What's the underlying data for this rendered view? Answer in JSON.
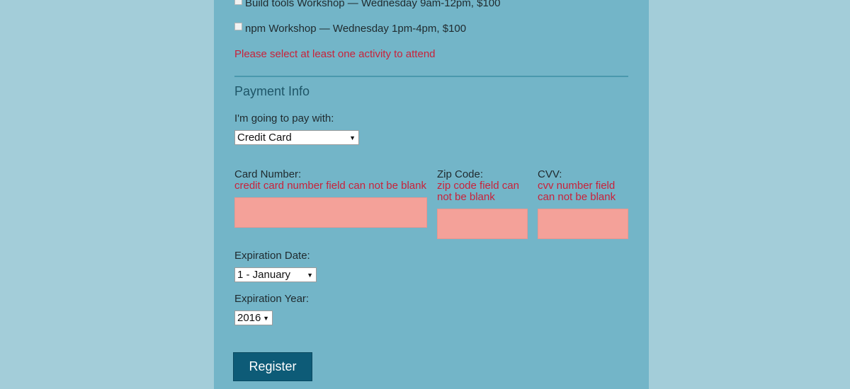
{
  "activities": [
    {
      "label": "Build tools Workshop — Wednesday 9am-12pm, $100",
      "checked": false
    },
    {
      "label": "npm Workshop — Wednesday 1pm-4pm, $100",
      "checked": false
    }
  ],
  "activities_error": "Please select at least one activity to attend",
  "payment": {
    "heading": "Payment Info",
    "pay_with_label": "I'm going to pay with:",
    "pay_with_value": "Credit Card",
    "card_number_label": "Card Number:",
    "card_number_error": "credit card number field can not be blank",
    "zip_label": "Zip Code:",
    "zip_error_line1": "zip code field can",
    "zip_error_line2": "not be blank",
    "cvv_label": "CVV:",
    "cvv_error_line1": "cvv number field",
    "cvv_error_line2": "can not be blank",
    "exp_date_label": "Expiration Date:",
    "exp_date_value": "1 - January",
    "exp_year_label": "Expiration Year:",
    "exp_year_value": "2016"
  },
  "register_label": "Register",
  "icons": {
    "dropdown_caret": "▼"
  },
  "colors": {
    "page_bg": "#a3cdd9",
    "panel_bg": "#73b5c8",
    "error_text": "#c9223a",
    "invalid_field_bg": "#f4a199",
    "heading_text": "#1e5567",
    "button_bg": "#0d5b77"
  }
}
